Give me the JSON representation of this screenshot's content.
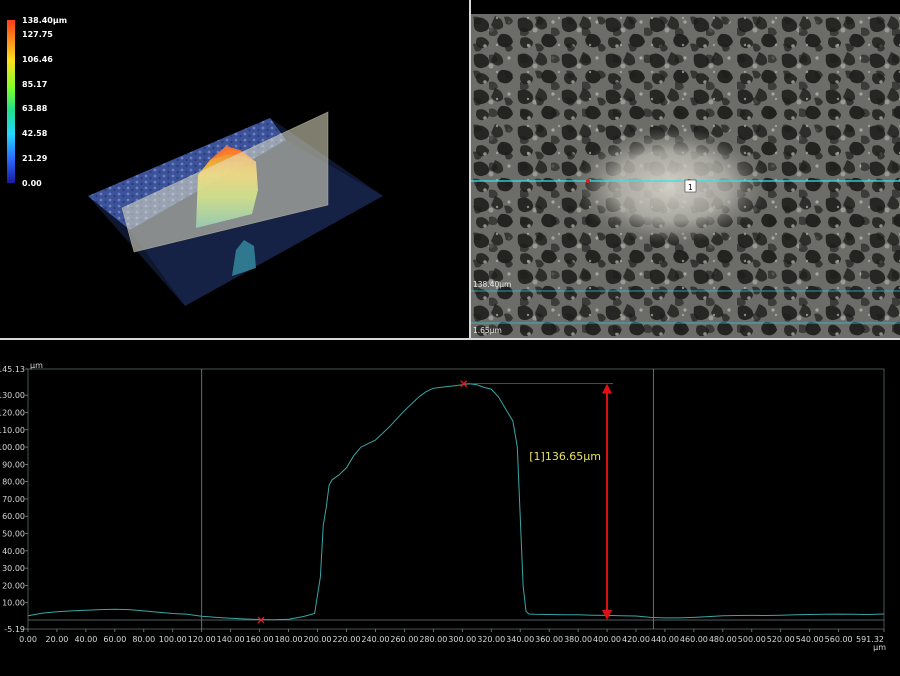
{
  "colorbar": {
    "labels": [
      "138.40µm",
      "127.75",
      "106.46",
      "85.17",
      "63.88",
      "42.58",
      "21.29",
      "0.00"
    ]
  },
  "micrograph": {
    "line_marker": "1",
    "scale_label_1": "138.40µm",
    "scale_label_2": "1.65µm"
  },
  "profile": {
    "annotation": "[1]136.65µm",
    "colors": {
      "profile_line": "#3aa6a6",
      "marker": "#e02020",
      "arrow": "#e01010",
      "annotation": "#e8e060"
    }
  },
  "chart_data": {
    "type": "line",
    "ylabel": "µm",
    "xlabel": "µm",
    "xlim": [
      0,
      591.32
    ],
    "ylim": [
      -5.19,
      145.13
    ],
    "x_tick_labels": [
      "0.00",
      "20.00",
      "40.00",
      "60.00",
      "80.00",
      "100.00",
      "120.00",
      "140.00",
      "160.00",
      "180.00",
      "200.00",
      "220.00",
      "240.00",
      "260.00",
      "280.00",
      "300.00",
      "320.00",
      "340.00",
      "360.00",
      "380.00",
      "400.00",
      "420.00",
      "440.00",
      "460.00",
      "480.00",
      "500.00",
      "520.00",
      "540.00",
      "560.00",
      "591.32"
    ],
    "y_tick_labels": [
      "145.13",
      "130.00",
      "120.00",
      "110.00",
      "100.00",
      "90.00",
      "80.00",
      "70.00",
      "60.00",
      "50.00",
      "40.00",
      "30.00",
      "20.00",
      "10.00",
      "-5.19"
    ],
    "cursor_lines_x": [
      120.0,
      432.0
    ],
    "markers": [
      {
        "x": 161.0,
        "y": 0.0
      },
      {
        "x": 301.0,
        "y": 136.6
      }
    ],
    "measurement": {
      "x": 400.0,
      "y_from": 0.0,
      "y_to": 136.65
    },
    "series": [
      {
        "x": [
          0,
          10,
          20,
          30,
          40,
          50,
          60,
          70,
          80,
          90,
          100,
          110,
          120,
          130,
          140,
          150,
          160,
          170,
          180,
          190,
          198,
          202,
          204,
          206,
          208,
          210,
          215,
          220,
          225,
          230,
          240,
          250,
          260,
          265,
          270,
          275,
          280,
          285,
          290,
          295,
          300,
          305,
          310,
          315,
          320,
          325,
          330,
          335,
          338,
          340,
          342,
          344,
          346,
          350,
          360,
          370,
          380,
          390,
          400,
          410,
          420,
          430,
          440,
          450,
          460,
          470,
          480,
          490,
          500,
          510,
          520,
          530,
          540,
          550,
          560,
          570,
          580,
          591.32
        ],
        "y": [
          2.5,
          4.0,
          4.8,
          5.3,
          5.6,
          6.0,
          6.2,
          6.0,
          5.3,
          4.5,
          3.8,
          3.3,
          2.2,
          1.5,
          1.0,
          0.6,
          0.3,
          0.2,
          0.5,
          2.0,
          3.8,
          25.0,
          55.0,
          65.0,
          78.0,
          81.0,
          84.0,
          88.0,
          95.0,
          100.0,
          104.0,
          112.0,
          121.0,
          125.0,
          129.0,
          132.0,
          134.0,
          134.5,
          135.0,
          135.5,
          136.0,
          136.6,
          136.0,
          134.5,
          133.5,
          129.0,
          122.0,
          115.0,
          100.0,
          60.0,
          20.0,
          5.0,
          3.5,
          3.3,
          3.2,
          3.1,
          3.0,
          2.8,
          2.7,
          2.5,
          2.3,
          1.5,
          1.2,
          1.2,
          1.5,
          2.0,
          2.5,
          2.6,
          2.7,
          2.6,
          2.8,
          3.0,
          3.2,
          3.3,
          3.4,
          3.3,
          3.2,
          3.5
        ]
      }
    ]
  }
}
